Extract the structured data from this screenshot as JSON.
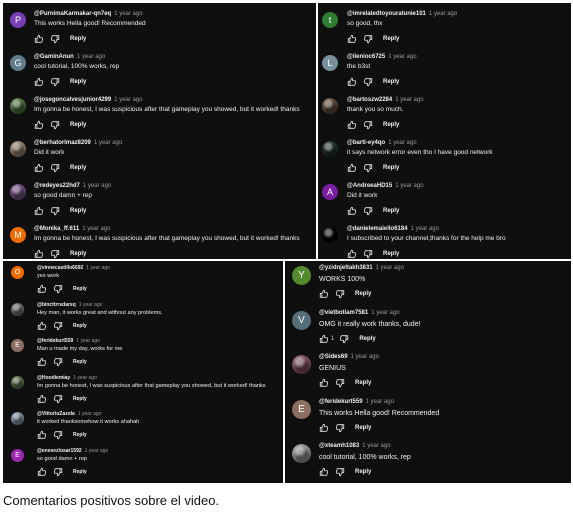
{
  "caption": "Comentarios positivos sobre el video.",
  "actions": {
    "reply_label": "Reply",
    "like_icon": "thumb-up-icon",
    "dislike_icon": "thumb-down-icon"
  },
  "panels": [
    {
      "comments": [
        {
          "user": "@PurnimaKarmakar-qn7eq",
          "time": "1 year ago",
          "text": "This works Hella good! Recommended",
          "avatar": {
            "letter": "P",
            "color": "#7b3fb5"
          }
        },
        {
          "user": "@GaminAnun",
          "time": "1 year ago",
          "text": "cool tutorial, 100% works, rep",
          "avatar": {
            "letter": "G",
            "color": "#5f7d8c"
          }
        },
        {
          "user": "@josegoncalvesjunior4299",
          "time": "1 year ago",
          "text": "Im gonna be honest, I was suspicious after that gameplay you showed, but it worked! thanks",
          "avatar": {
            "letter": "",
            "color": "#4a6b3a"
          }
        },
        {
          "user": "@berhatorlmaz8209",
          "time": "1 year ago",
          "text": "Did it work",
          "avatar": {
            "letter": "",
            "color": "#8a7a66"
          }
        },
        {
          "user": "@redeyes22hd7",
          "time": "1 year ago",
          "text": "so good damn + rep",
          "avatar": {
            "letter": "",
            "color": "#6b4a7a"
          }
        },
        {
          "user": "@Monika_ff.611",
          "time": "1 year ago",
          "text": "Im gonna be honest, I was suspicious after that gameplay you showed, but it worked! thanks",
          "avatar": {
            "letter": "M",
            "color": "#ef6c00"
          }
        }
      ]
    },
    {
      "comments": [
        {
          "user": "@imrelatedtoyouratunie101",
          "time": "1 year ago",
          "text": "so good, thx",
          "avatar": {
            "letter": "t",
            "color": "#2e7d32"
          }
        },
        {
          "user": "@ilenioc6725",
          "time": "1 year ago",
          "text": "the b3st",
          "avatar": {
            "letter": "L",
            "color": "#78909c"
          }
        },
        {
          "user": "@bartoszw2284",
          "time": "1 year ago",
          "text": "thank you so much.",
          "avatar": {
            "letter": "",
            "color": "#5a4a3a"
          }
        },
        {
          "user": "@barti-ey4qo",
          "time": "1 year ago",
          "text": "it says network error even tho I have good network",
          "avatar": {
            "letter": "",
            "color": "#203028"
          }
        },
        {
          "user": "@AndreeaHD15",
          "time": "1 year ago",
          "text": "Did it work",
          "avatar": {
            "letter": "A",
            "color": "#7b1fa2"
          }
        },
        {
          "user": "@danielemaiello6184",
          "time": "1 year ago",
          "text": "I subscribed to your channel,thanks for the help me bro",
          "avatar": {
            "letter": "",
            "color": "#050505"
          }
        }
      ]
    },
    {
      "comments": [
        {
          "user": "@vinnecastillo6692",
          "time": "1 year ago",
          "text": "yes work",
          "avatar": {
            "letter": "O",
            "color": "#ef6c00"
          }
        },
        {
          "user": "@bincttrrsdarsq",
          "time": "1 year ago",
          "text": "Hey man, it works great and without any problems.",
          "avatar": {
            "letter": "",
            "color": "#6a6a6a"
          }
        },
        {
          "user": "@feridekurt559",
          "time": "1 year ago",
          "text": "Man u made my day, works for me",
          "avatar": {
            "letter": "E",
            "color": "#8d6e63"
          }
        },
        {
          "user": "@Hoodiemiay",
          "time": "1 year ago",
          "text": "Im gonna be honest, I was suspicious after that gameplay you showed, but it worked! thanks",
          "avatar": {
            "letter": "",
            "color": "#5a6a4a"
          }
        },
        {
          "user": "@VittorioZazola",
          "time": "1 year ago",
          "text": "it worked thanksomehow it works ahahah",
          "avatar": {
            "letter": "",
            "color": "#7a8a9a"
          }
        },
        {
          "user": "@enesezlosar1592",
          "time": "1 year ago",
          "text": "so good damn + rep",
          "avatar": {
            "letter": "E",
            "color": "#9c27b0"
          }
        }
      ]
    },
    {
      "comments": [
        {
          "user": "@yzidnjeltakh3831",
          "time": "1 year ago",
          "text": "WORKS 100%",
          "avatar": {
            "letter": "Y",
            "color": "#558b2f"
          }
        },
        {
          "user": "@vietbotiam7581",
          "time": "1 year ago",
          "text": "OMG it really work thanks, dude!",
          "avatar": {
            "letter": "V",
            "color": "#546e7a"
          },
          "likes": "1"
        },
        {
          "user": "@Sides69",
          "time": "1 year ago",
          "text": "GENIUS",
          "avatar": {
            "letter": "",
            "color": "#7a4a5a"
          }
        },
        {
          "user": "@feridekurt559",
          "time": "1 year ago",
          "text": "This works Hella good! Recommended",
          "avatar": {
            "letter": "E",
            "color": "#8d6e63"
          }
        },
        {
          "user": "@xteamh1083",
          "time": "1 year ago",
          "text": "cool tutorial, 100% works, rep",
          "avatar": {
            "letter": "",
            "color": "#8a8a8a"
          }
        }
      ]
    }
  ]
}
